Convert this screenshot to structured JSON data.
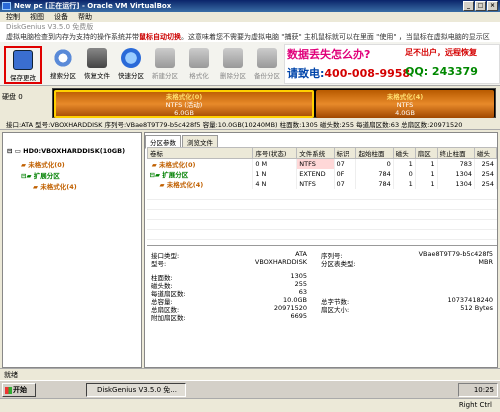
{
  "window": {
    "title": "New pc [正在运行] - Oracle VM VirtualBox"
  },
  "vb_menu": [
    "控制",
    "视图",
    "设备",
    "帮助"
  ],
  "dg_title": "DiskGenius V3.5.0 免费版",
  "dg_notice": {
    "text": "虚拟电脑检查到内存为支持的操作系统并带",
    "bold": "鼠标自动切换",
    "rest": "。这意味着您不需要为虚拟电脑 \"捕获\" 主机鼠标就可以在里面 \"使用\" ，当鼠标在虚拟电脑的显示区"
  },
  "toolbar": [
    {
      "label": "保存更改",
      "icon": "save-icon"
    },
    {
      "label": "搜索分区",
      "icon": "search-partition-icon"
    },
    {
      "label": "恢复文件",
      "icon": "recover-file-icon"
    },
    {
      "label": "快速分区",
      "icon": "quick-partition-icon"
    },
    {
      "label": "新建分区",
      "icon": "new-partition-icon"
    },
    {
      "label": "格式化",
      "icon": "format-icon"
    },
    {
      "label": "删除分区",
      "icon": "delete-partition-icon"
    },
    {
      "label": "备份分区",
      "icon": "backup-partition-icon"
    }
  ],
  "ad": {
    "line1": "数据丢失怎么办?",
    "line2": "请致电:",
    "phone": "400-008-9958",
    "line3": "足不出户，远程恢复",
    "line4": "QQ: 243379"
  },
  "disk_map": {
    "disk_label": "硬盘 0",
    "segments": [
      {
        "name": "未格式化(0)",
        "fs": "NTFS (活动)",
        "size": "6.0GB"
      },
      {
        "name": "未格式化(4)",
        "fs": "NTFS",
        "size": "4.0GB"
      }
    ]
  },
  "info_bar": "接口:ATA 型号:VBOXHARDDISK 序列号:VBae8T9T79-b5c428f5 容量:10.0GB(10240MB) 柱面数:1305 磁头数:255 每道扇区数:63 总扇区数:20971520",
  "tree": {
    "disk": "HD0:VBOXHARDDISK(10GB)",
    "items": [
      "未格式化(0)",
      "扩展分区",
      "未格式化(4)"
    ]
  },
  "tabs": [
    "分区参数",
    "浏览文件"
  ],
  "partition_table": {
    "headers": [
      "卷标",
      "序号(状态)",
      "文件系统",
      "标识",
      "起始柱面",
      "磁头",
      "扇区",
      "终止柱面",
      "磁头"
    ],
    "rows": [
      [
        "未格式化(0)",
        "0 M",
        "NTFS",
        "07",
        "0",
        "1",
        "1",
        "783",
        "254"
      ],
      [
        "扩展分区",
        "1 N",
        "EXTEND",
        "0F",
        "784",
        "0",
        "1",
        "1304",
        "254"
      ],
      [
        "未格式化(4)",
        "4 N",
        "NTFS",
        "07",
        "784",
        "1",
        "1",
        "1304",
        "254"
      ]
    ]
  },
  "props": {
    "left": [
      {
        "k": "接口类型:",
        "v": "ATA"
      },
      {
        "k": "型号:",
        "v": "VBOXHARDDISK"
      },
      {
        "k": "柱面数:",
        "v": "1305"
      },
      {
        "k": "磁头数:",
        "v": "255"
      },
      {
        "k": "每道扇区数:",
        "v": "63"
      },
      {
        "k": "总容量:",
        "v": "10.0GB"
      },
      {
        "k": "总扇区数:",
        "v": "20971520"
      },
      {
        "k": "附加扇区数:",
        "v": "6695"
      }
    ],
    "right": [
      {
        "k": "序列号:",
        "v": "VBae8T9T79-b5c428f5"
      },
      {
        "k": "分区表类型:",
        "v": "MBR"
      },
      {
        "k": "总字节数:",
        "v": "10737418240"
      },
      {
        "k": "扇区大小:",
        "v": "512 Bytes"
      }
    ]
  },
  "status": "就绪",
  "taskbar": {
    "start": "开始",
    "task": "DiskGenius V3.5.0 免...",
    "clock": "10:25"
  },
  "vb_status": "Right Ctrl"
}
